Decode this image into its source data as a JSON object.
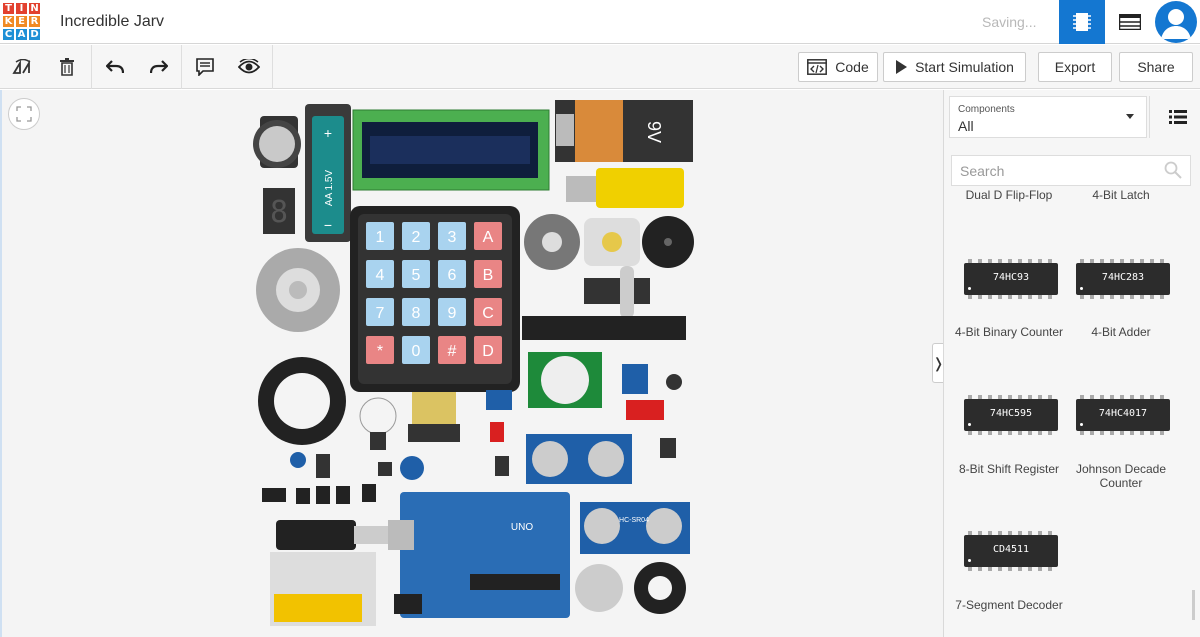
{
  "header": {
    "logo_letters": [
      "T",
      "I",
      "N",
      "K",
      "E",
      "R",
      "C",
      "A",
      "D"
    ],
    "title": "Incredible Jarv",
    "status": "Saving...",
    "accent": "#1477d1"
  },
  "toolbar": {
    "tools": [
      "rotate-icon",
      "trash-icon",
      "undo-icon",
      "redo-icon",
      "notes-icon",
      "visibility-icon"
    ],
    "code_label": "Code",
    "simulate_label": "Start Simulation",
    "export_label": "Export",
    "share_label": "Share"
  },
  "panel": {
    "components_label": "Components",
    "components_value": "All",
    "search_placeholder": "Search",
    "partial_names": [
      "Dual D Flip-Flop",
      "4-Bit Latch"
    ],
    "items": [
      {
        "chip": "74HC93",
        "name": "4-Bit Binary Counter"
      },
      {
        "chip": "74HC283",
        "name": "4-Bit Adder"
      },
      {
        "chip": "74HC595",
        "name": "8-Bit Shift Register"
      },
      {
        "chip": "74HC4017",
        "name": "Johnson Decade Counter"
      },
      {
        "chip": "CD4511",
        "name": "7-Segment Decoder"
      }
    ]
  },
  "canvas": {
    "battery_label": "9V",
    "aa_label": "AA 1.5V",
    "keypad_keys": [
      "1",
      "2",
      "3",
      "A",
      "4",
      "5",
      "6",
      "B",
      "7",
      "8",
      "9",
      "C",
      "*",
      "0",
      "#",
      "D"
    ],
    "arduino_label": "UNO",
    "ultrasonic_label": "HC-SR04",
    "seven_seg_digit": "8"
  }
}
